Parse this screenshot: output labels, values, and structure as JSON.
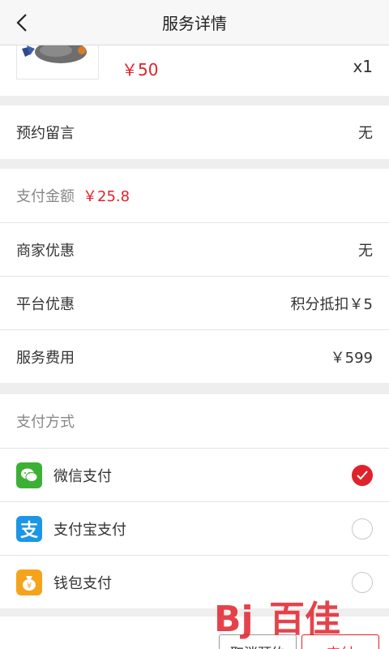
{
  "header": {
    "title": "服务详情",
    "back_icon": "chevron-left-icon"
  },
  "product": {
    "price": "￥50",
    "quantity": "x1"
  },
  "message": {
    "label": "预约留言",
    "value": "无"
  },
  "summary": {
    "amount_label": "支付金额",
    "amount_value": "￥25.8",
    "rows": [
      {
        "label": "商家优惠",
        "value": "无"
      },
      {
        "label": "平台优惠",
        "value": "积分抵扣￥5"
      },
      {
        "label": "服务费用",
        "value": "￥599"
      }
    ]
  },
  "payment": {
    "title": "支付方式",
    "methods": [
      {
        "label": "微信支付",
        "icon": "wechat-icon",
        "color": "#3cb034",
        "selected": true
      },
      {
        "label": "支付宝支付",
        "icon": "alipay-icon",
        "color": "#1c96e6",
        "selected": false
      },
      {
        "label": "钱包支付",
        "icon": "wallet-icon",
        "color": "#f5a31a",
        "selected": false
      }
    ]
  },
  "footer": {
    "cancel_label": "取消预约",
    "pay_label": "支付"
  },
  "watermark": {
    "text": "百佳"
  },
  "colors": {
    "accent": "#e0222b",
    "background": "#eeeeee"
  }
}
